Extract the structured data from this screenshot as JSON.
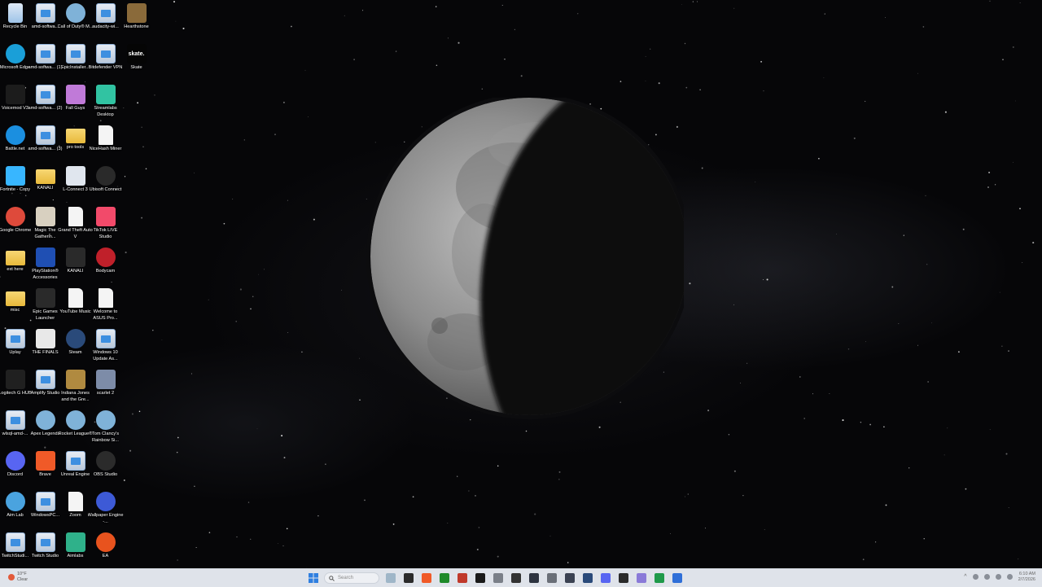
{
  "desktop": {
    "columns": [
      [
        {
          "name": "desktop-icon-recycle-bin",
          "label": "Recycle Bin",
          "icon": "recycle-bin-icon",
          "kind": "bin",
          "color": "#9ec3e8"
        },
        {
          "name": "desktop-icon-microsoft-edge",
          "label": "Microsoft Edge",
          "icon": "edge-icon",
          "kind": "round",
          "color": "#1a9fd8"
        },
        {
          "name": "desktop-icon-voicemod",
          "label": "Voicemod V3",
          "icon": "voicemod-icon",
          "kind": "solid",
          "color": "#1c1c1c"
        },
        {
          "name": "desktop-icon-battle-net",
          "label": "Battle.net",
          "icon": "battlenet-icon",
          "kind": "round",
          "color": "#1b8fe0"
        },
        {
          "name": "desktop-icon-fortnite-copy",
          "label": "Fortnite - Copy",
          "icon": "fortnite-icon",
          "kind": "solid",
          "color": "#38b6ff"
        },
        {
          "name": "desktop-icon-google-chrome",
          "label": "Google Chrome",
          "icon": "chrome-icon",
          "kind": "round",
          "color": "#de4a3b"
        },
        {
          "name": "desktop-icon-ext-here",
          "label": "ext here",
          "icon": "folder-icon",
          "kind": "folder",
          "color": "#f0c44c"
        },
        {
          "name": "desktop-icon-misc",
          "label": "misc",
          "icon": "folder-icon",
          "kind": "folder",
          "color": "#f0c44c"
        },
        {
          "name": "desktop-icon-uplay",
          "label": "Uplay",
          "icon": "file-icon",
          "kind": "file",
          "color": "#c8d6e6"
        },
        {
          "name": "desktop-icon-logitech-g-hub",
          "label": "Logitech G HUB",
          "icon": "logitech-icon",
          "kind": "solid",
          "color": "#202020"
        },
        {
          "name": "desktop-icon-wlsql-amd",
          "label": "wlsql-amd-...",
          "icon": "file-icon",
          "kind": "file",
          "color": "#c8d6e6"
        },
        {
          "name": "desktop-icon-discord",
          "label": "Discord",
          "icon": "discord-icon",
          "kind": "round",
          "color": "#5865f2"
        },
        {
          "name": "desktop-icon-aim-lab",
          "label": "Aim Lab",
          "icon": "aimlab-icon",
          "kind": "round",
          "color": "#4aa3df"
        },
        {
          "name": "desktop-icon-twitchstudio",
          "label": "TwitchStudi...",
          "icon": "file-icon",
          "kind": "file",
          "color": "#c8d6e6"
        }
      ],
      [
        {
          "name": "desktop-icon-amd-software",
          "label": "amd-softwa...",
          "icon": "file-icon",
          "kind": "file",
          "color": "#c8d6e6"
        },
        {
          "name": "desktop-icon-amd-software-1",
          "label": "amd-softwa... (1)",
          "icon": "file-icon",
          "kind": "file",
          "color": "#c8d6e6"
        },
        {
          "name": "desktop-icon-amd-software-2",
          "label": "amd-softwa... (2)",
          "icon": "file-icon",
          "kind": "file",
          "color": "#c8d6e6"
        },
        {
          "name": "desktop-icon-amd-software-3",
          "label": "amd-softwa... (3)",
          "icon": "file-icon",
          "kind": "file",
          "color": "#c8d6e6"
        },
        {
          "name": "desktop-icon-kanali",
          "label": "KANALI",
          "icon": "folder-icon",
          "kind": "folder",
          "color": "#f0c44c"
        },
        {
          "name": "desktop-icon-magic-the-gathering",
          "label": "Magic The Gatherin...",
          "icon": "mtg-icon",
          "kind": "solid",
          "color": "#d8d0c0"
        },
        {
          "name": "desktop-icon-playstation-accessories",
          "label": "PlayStation® Accessories",
          "icon": "playstation-icon",
          "kind": "solid",
          "color": "#1f4fb3"
        },
        {
          "name": "desktop-icon-epic-games-launcher",
          "label": "Epic Games Launcher",
          "icon": "epic-games-icon",
          "kind": "solid",
          "color": "#2a2a2a"
        },
        {
          "name": "desktop-icon-the-finals",
          "label": "THE FINALS",
          "icon": "the-finals-icon",
          "kind": "solid",
          "color": "#e8e8e8"
        },
        {
          "name": "desktop-icon-amplify-studio",
          "label": "Amplify Studio",
          "icon": "file-icon",
          "kind": "file",
          "color": "#c8d6e6"
        },
        {
          "name": "desktop-icon-apex-legends",
          "label": "Apex Legends",
          "icon": "apex-icon",
          "kind": "round",
          "color": "#7fb2d8"
        },
        {
          "name": "desktop-icon-brave",
          "label": "Brave",
          "icon": "brave-icon",
          "kind": "solid",
          "color": "#f05a28"
        },
        {
          "name": "desktop-icon-windowspc",
          "label": "WindowsPC...",
          "icon": "file-icon",
          "kind": "file",
          "color": "#c8d6e6"
        },
        {
          "name": "desktop-icon-twitch-studio",
          "label": "Twitch Studio",
          "icon": "file-icon",
          "kind": "file",
          "color": "#c8d6e6"
        }
      ],
      [
        {
          "name": "desktop-icon-call-of-duty",
          "label": "Call of Duty® M...",
          "icon": "globe-icon",
          "kind": "round",
          "color": "#7fb2d8"
        },
        {
          "name": "desktop-icon-epicinstaller",
          "label": "EpicInstaller...",
          "icon": "file-icon",
          "kind": "file",
          "color": "#c8d6e6"
        },
        {
          "name": "desktop-icon-fall-guys",
          "label": "Fall Guys",
          "icon": "fall-guys-icon",
          "kind": "solid",
          "color": "#c07ad8"
        },
        {
          "name": "desktop-icon-pro-tools",
          "label": "pro tools",
          "icon": "folder-icon",
          "kind": "folder",
          "color": "#f0c44c"
        },
        {
          "name": "desktop-icon-l-connect-3",
          "label": "L-Connect 3",
          "icon": "lconnect-icon",
          "kind": "solid",
          "color": "#e0e6ee"
        },
        {
          "name": "desktop-icon-gta-v",
          "label": "Grand Theft Auto V",
          "icon": "doc-icon",
          "kind": "doc",
          "color": "#f2f2f2"
        },
        {
          "name": "desktop-icon-kanali-2",
          "label": "KANALI",
          "icon": "kanali-icon",
          "kind": "solid",
          "color": "#2a2a2a"
        },
        {
          "name": "desktop-icon-youtube-music",
          "label": "YouTube Music",
          "icon": "doc-icon",
          "kind": "doc",
          "color": "#f2f2f2"
        },
        {
          "name": "desktop-icon-steam",
          "label": "Steam",
          "icon": "steam-icon",
          "kind": "round",
          "color": "#2a4a7a"
        },
        {
          "name": "desktop-icon-indiana-jones",
          "label": "Indiana Jones and the Gre...",
          "icon": "indiana-jones-icon",
          "kind": "solid",
          "color": "#b08a40"
        },
        {
          "name": "desktop-icon-rocket-league",
          "label": "Rocket League®",
          "icon": "globe-icon",
          "kind": "round",
          "color": "#7fb2d8"
        },
        {
          "name": "desktop-icon-unreal-engine",
          "label": "Unreal Engine",
          "icon": "file-icon",
          "kind": "file",
          "color": "#c8d6e6"
        },
        {
          "name": "desktop-icon-zoom",
          "label": "Zoom",
          "icon": "doc-icon",
          "kind": "doc",
          "color": "#f2f2f2"
        },
        {
          "name": "desktop-icon-aimlabs",
          "label": "Aimlabs",
          "icon": "aimlabs-icon",
          "kind": "solid",
          "color": "#2fb18a"
        }
      ],
      [
        {
          "name": "desktop-icon-audacity",
          "label": "audacity-wi...",
          "icon": "file-icon",
          "kind": "file",
          "color": "#c8d6e6"
        },
        {
          "name": "desktop-icon-bitdefender-vpn",
          "label": "Bitdefender VPN",
          "icon": "file-icon",
          "kind": "file",
          "color": "#c8d6e6"
        },
        {
          "name": "desktop-icon-streamlabs-desktop",
          "label": "Streamlabs Desktop",
          "icon": "streamlabs-icon",
          "kind": "solid",
          "color": "#31c3a2"
        },
        {
          "name": "desktop-icon-nicehash-miner",
          "label": "NiceHash Miner",
          "icon": "doc-icon",
          "kind": "doc",
          "color": "#f2f2f2"
        },
        {
          "name": "desktop-icon-ubisoft-connect",
          "label": "Ubisoft Connect",
          "icon": "ubisoft-icon",
          "kind": "round",
          "color": "#2a2a2a"
        },
        {
          "name": "desktop-icon-tiktok-live-studio",
          "label": "TikTok LIVE Studio",
          "icon": "tiktok-icon",
          "kind": "solid",
          "color": "#f24a6a"
        },
        {
          "name": "desktop-icon-bodycam",
          "label": "Bodycam",
          "icon": "bodycam-icon",
          "kind": "round",
          "color": "#c0202a"
        },
        {
          "name": "desktop-icon-welcome-asus",
          "label": "Welcome to ASUS Pro...",
          "icon": "doc-icon",
          "kind": "doc",
          "color": "#f2f2f2"
        },
        {
          "name": "desktop-icon-windows-10-update",
          "label": "Windows 10 Update As...",
          "icon": "file-icon",
          "kind": "file",
          "color": "#c8d6e6"
        },
        {
          "name": "desktop-icon-scarlet-2",
          "label": "scarlet 2",
          "icon": "scarlet-icon",
          "kind": "solid",
          "color": "#7d8ca8"
        },
        {
          "name": "desktop-icon-rainbow-six",
          "label": "Tom Clancy's Rainbow Si...",
          "icon": "globe-icon",
          "kind": "round",
          "color": "#7fb2d8"
        },
        {
          "name": "desktop-icon-obs-studio",
          "label": "OBS Studio",
          "icon": "obs-icon",
          "kind": "round",
          "color": "#2b2b2b"
        },
        {
          "name": "desktop-icon-wallpaper-engine",
          "label": "Wallpaper Engine -...",
          "icon": "wallpaper-engine-icon",
          "kind": "round",
          "color": "#3d5ad6"
        },
        {
          "name": "desktop-icon-ea",
          "label": "EA",
          "icon": "ea-icon",
          "kind": "round",
          "color": "#e8531e"
        }
      ],
      [
        {
          "name": "desktop-icon-hearthstone",
          "label": "Hearthstone",
          "icon": "hearthstone-icon",
          "kind": "solid",
          "color": "#8a6a3a"
        },
        {
          "name": "desktop-icon-skate",
          "label": "Skate",
          "icon": "skate-icon",
          "kind": "skate",
          "color": "#050505"
        }
      ]
    ]
  },
  "taskbar": {
    "weather": {
      "temp": "10°F",
      "condition": "Clear"
    },
    "search_placeholder": "Search",
    "apps": [
      {
        "name": "taskbar-widgets",
        "icon": "widgets-icon",
        "color": "#9fb6c8"
      },
      {
        "name": "taskbar-file-explorer",
        "icon": "file-explorer-icon",
        "color": "#2b2b2b"
      },
      {
        "name": "taskbar-brave",
        "icon": "brave-icon",
        "color": "#f05a28"
      },
      {
        "name": "taskbar-xbox",
        "icon": "xbox-icon",
        "color": "#1f8a2a"
      },
      {
        "name": "taskbar-app-red",
        "icon": "app-icon",
        "color": "#c0392b"
      },
      {
        "name": "taskbar-terminal",
        "icon": "terminal-icon",
        "color": "#1a1a1a"
      },
      {
        "name": "taskbar-app-gray",
        "icon": "app-icon",
        "color": "#7a7f88"
      },
      {
        "name": "taskbar-logitech",
        "icon": "logitech-icon",
        "color": "#333333"
      },
      {
        "name": "taskbar-app-dark",
        "icon": "app-icon",
        "color": "#2e3440"
      },
      {
        "name": "taskbar-app-circle",
        "icon": "app-icon",
        "color": "#6a6f78"
      },
      {
        "name": "taskbar-app-globe",
        "icon": "globe-icon",
        "color": "#3b4252"
      },
      {
        "name": "taskbar-steam",
        "icon": "steam-icon",
        "color": "#2a4a7a"
      },
      {
        "name": "taskbar-discord",
        "icon": "discord-icon",
        "color": "#5865f2"
      },
      {
        "name": "taskbar-app-box",
        "icon": "app-icon",
        "color": "#2b2b2b"
      },
      {
        "name": "taskbar-app-purple",
        "icon": "app-icon",
        "color": "#8a7ad8"
      },
      {
        "name": "taskbar-app-green",
        "icon": "app-icon",
        "color": "#1f9a4a"
      },
      {
        "name": "taskbar-app-blue",
        "icon": "app-icon",
        "color": "#2f6fd8"
      }
    ],
    "clock": {
      "time": "6:10 AM",
      "date": "2/7/2026"
    }
  }
}
